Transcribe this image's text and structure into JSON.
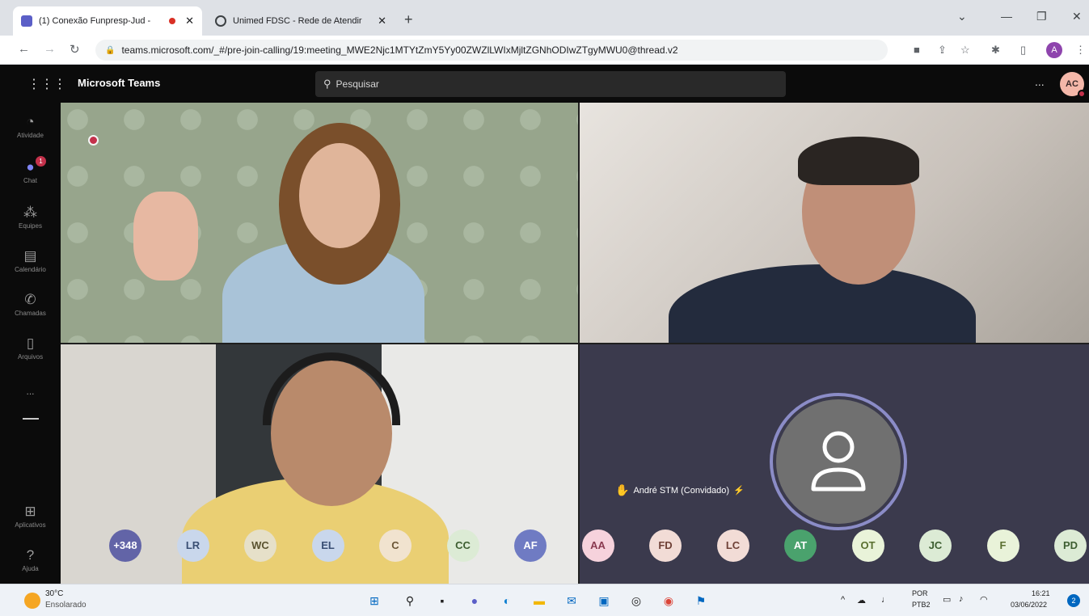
{
  "browser": {
    "tabs": [
      {
        "title": "(1) Conexão Funpresp-Jud -",
        "active": true
      },
      {
        "title": "Unimed FDSC - Rede de Atendir",
        "active": false
      }
    ],
    "new_tab_symbol": "+",
    "url": "teams.microsoft.com/_#/pre-join-calling/19:meeting_MWE2Njc1MTYtZmY5Yy00ZWZlLWIxMjltZGNhODIwZTgyMWU0@thread.v2",
    "profile_initial": "A"
  },
  "teams": {
    "app_title": "Microsoft Teams",
    "search_placeholder": "Pesquisar",
    "user_initials": "AC",
    "rail": [
      {
        "label": "Atividade",
        "icon": "bell-icon"
      },
      {
        "label": "Chat",
        "icon": "chat-icon",
        "badge": "1"
      },
      {
        "label": "Equipes",
        "icon": "teams-icon"
      },
      {
        "label": "Calendário",
        "icon": "calendar-icon"
      },
      {
        "label": "Chamadas",
        "icon": "phone-icon"
      },
      {
        "label": "Arquivos",
        "icon": "file-icon"
      },
      {
        "label": "Aplicativos",
        "icon": "apps-icon"
      },
      {
        "label": "Ajuda",
        "icon": "help-icon"
      }
    ],
    "more_symbol": "...",
    "participant_label": "André STM (Convidado)",
    "overflow_count": "+348",
    "roster": [
      {
        "initials": "LR",
        "bg": "#c9d7ec",
        "fg": "#3a4f74"
      },
      {
        "initials": "WC",
        "bg": "#e6e0c9",
        "fg": "#5b5330"
      },
      {
        "initials": "EL",
        "bg": "#c9d7ec",
        "fg": "#3a4f74"
      },
      {
        "initials": "C",
        "bg": "#f1e3cf",
        "fg": "#6b5636"
      },
      {
        "initials": "CC",
        "bg": "#dcebd5",
        "fg": "#3d5e31"
      },
      {
        "initials": "AF",
        "bg": "#6f7bc3",
        "fg": "#ffffff"
      },
      {
        "initials": "AA",
        "bg": "#f6d2dc",
        "fg": "#8a3a50"
      },
      {
        "initials": "FD",
        "bg": "#f2dcd6",
        "fg": "#6f4137"
      },
      {
        "initials": "LC",
        "bg": "#f2dcd6",
        "fg": "#6f4137"
      },
      {
        "initials": "AT",
        "bg": "#4aa26d",
        "fg": "#ffffff"
      },
      {
        "initials": "OT",
        "bg": "#e9f3d9",
        "fg": "#5a7030"
      },
      {
        "initials": "JC",
        "bg": "#dcebd5",
        "fg": "#3d5e31"
      },
      {
        "initials": "F",
        "bg": "#e9f3d9",
        "fg": "#5a7030"
      },
      {
        "initials": "PD",
        "bg": "#dcebd5",
        "fg": "#3d5e31"
      }
    ]
  },
  "taskbar": {
    "temperature": "30°C",
    "weather": "Ensolarado",
    "lang_top": "POR",
    "lang_bottom": "PTB2",
    "time": "16:21",
    "date": "03/06/2022",
    "notifications": "2"
  }
}
